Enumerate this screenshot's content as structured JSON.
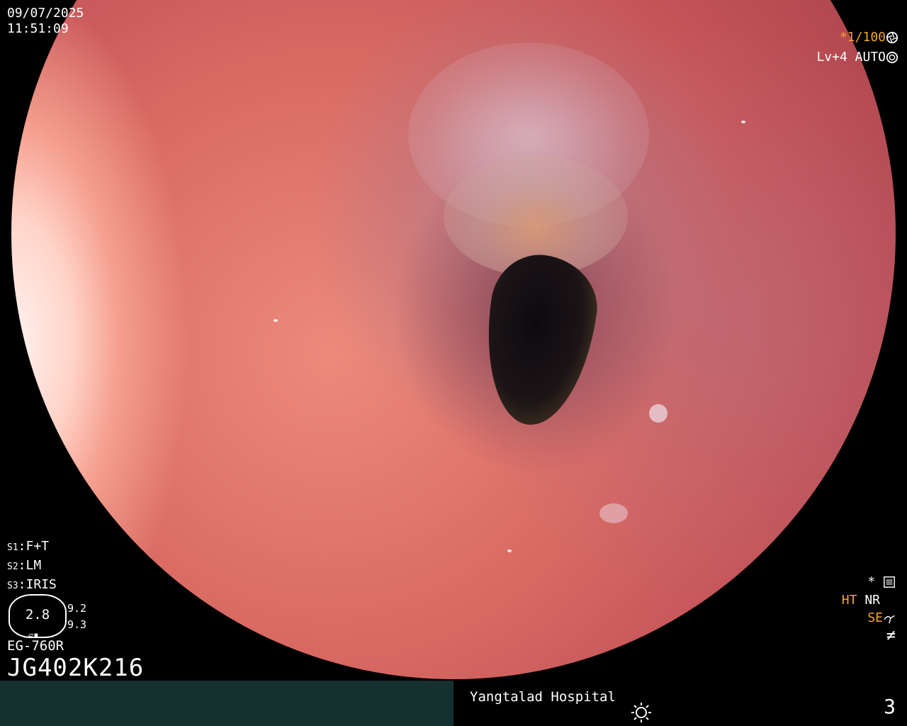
{
  "overlay": {
    "date": "09/07/2025",
    "time": "11:51:09",
    "shutter": "*1/100",
    "shutter_icon": "aperture-icon",
    "level": "Lv+4",
    "mode": "AUTO",
    "mode_icon": "metering-icon"
  },
  "settings": [
    {
      "key": "S1",
      "value": "F+T"
    },
    {
      "key": "S2",
      "value": "LM"
    },
    {
      "key": "S3",
      "value": "IRIS"
    }
  ],
  "aperture": {
    "value": "2.8",
    "upper": "9.2",
    "lower": "9.3",
    "marks": "▱▪"
  },
  "scope": {
    "model": "EG-760R",
    "serial": "JG402K216"
  },
  "status_right": {
    "star": "*",
    "ht": "HT",
    "nr": "NR",
    "se": "SE",
    "freeze_symbol": "≠"
  },
  "footer": {
    "hospital": "Yangtalad Hospital",
    "page": "3"
  },
  "colors": {
    "accent": "#f3a623",
    "footer_bar": "#14302f"
  }
}
